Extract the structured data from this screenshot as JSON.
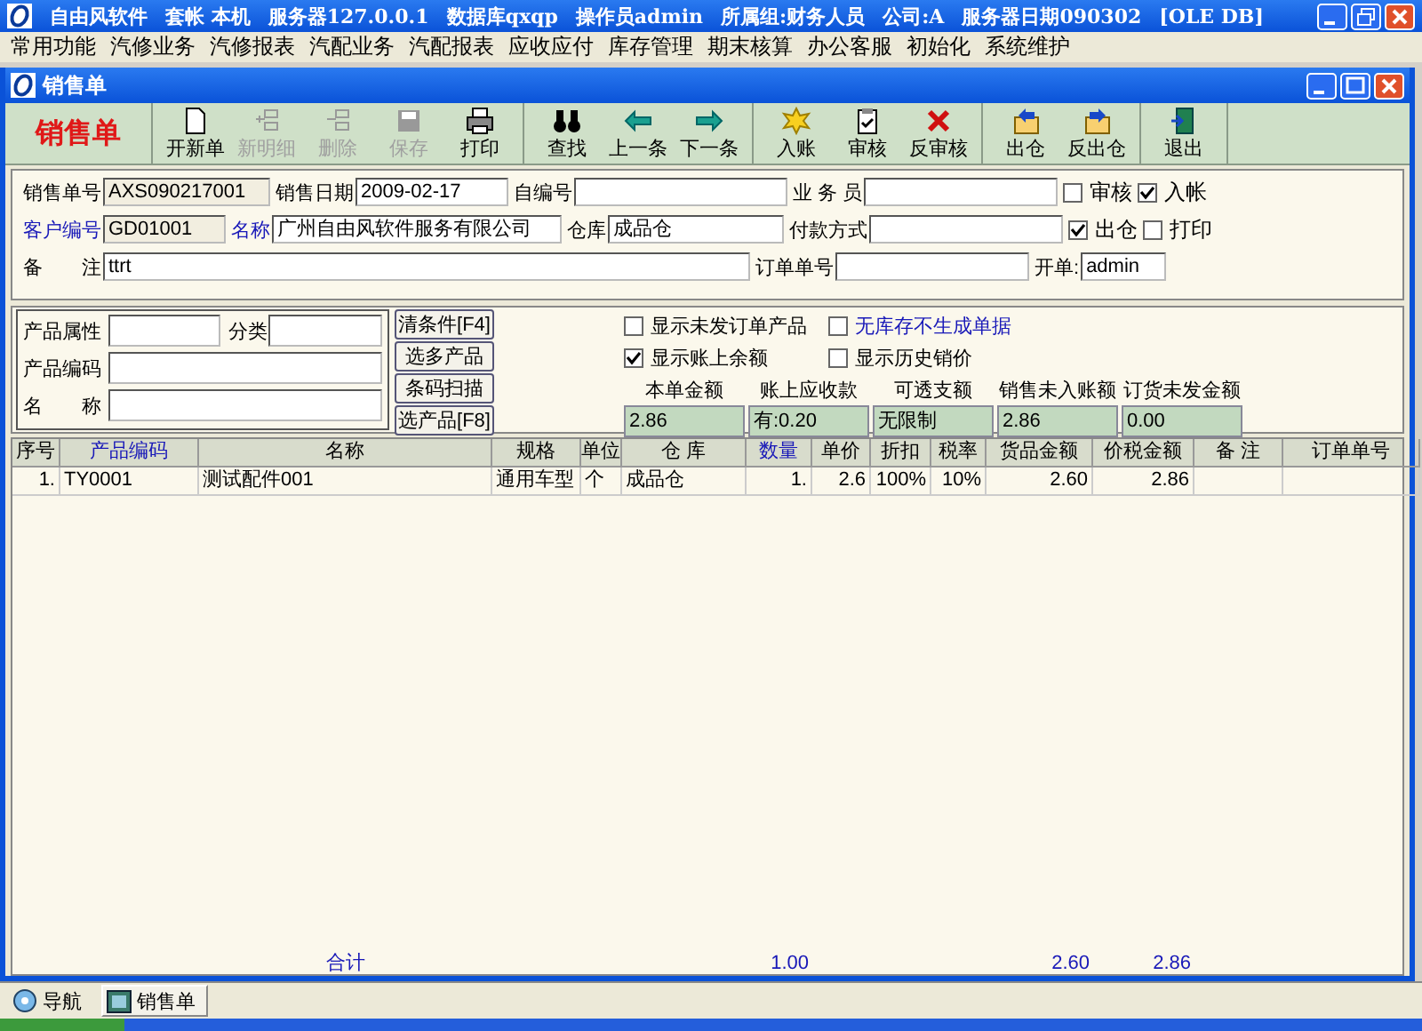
{
  "app_title": {
    "segments": [
      "自由风软件",
      "套帐 本机",
      "服务器127.0.0.1",
      "数据库qxqp",
      "操作员admin",
      "所属组:财务人员",
      "公司:A",
      "服务器日期090302",
      "[OLE DB]"
    ]
  },
  "menu": [
    "常用功能",
    "汽修业务",
    "汽修报表",
    "汽配业务",
    "汽配报表",
    "应收应付",
    "库存管理",
    "期末核算",
    "办公客服",
    "初始化",
    "系统维护"
  ],
  "window": {
    "title": "销售单"
  },
  "toolbar": {
    "heading": "销售单",
    "groups": [
      [
        {
          "kind": "new",
          "label": "开新单",
          "disabled": false
        },
        {
          "kind": "add-row",
          "label": "新明细",
          "disabled": true
        },
        {
          "kind": "delete",
          "label": "删除",
          "disabled": true
        },
        {
          "kind": "save",
          "label": "保存",
          "disabled": true
        },
        {
          "kind": "print",
          "label": "打印",
          "disabled": false
        }
      ],
      [
        {
          "kind": "find",
          "label": "查找",
          "disabled": false
        },
        {
          "kind": "prev",
          "label": "上一条",
          "disabled": false
        },
        {
          "kind": "next",
          "label": "下一条",
          "disabled": false
        }
      ],
      [
        {
          "kind": "post",
          "label": "入账",
          "disabled": false
        },
        {
          "kind": "audit",
          "label": "审核",
          "disabled": false
        },
        {
          "kind": "unaudit",
          "label": "反审核",
          "disabled": false
        }
      ],
      [
        {
          "kind": "out",
          "label": "出仓",
          "disabled": false
        },
        {
          "kind": "unout",
          "label": "反出仓",
          "disabled": false
        }
      ],
      [
        {
          "kind": "exit",
          "label": "退出",
          "disabled": false
        }
      ]
    ]
  },
  "form": {
    "fields": [
      {
        "kind": "field",
        "label": "销售单号",
        "value": "AXS090217001",
        "readonly": true,
        "link": false
      },
      {
        "kind": "field",
        "label": "销售日期",
        "value": "2009-02-17",
        "readonly": false,
        "link": false
      },
      {
        "kind": "field",
        "label": "自编号",
        "readonly": false,
        "link": false
      },
      {
        "kind": "field",
        "label": "业 务 员",
        "readonly": false,
        "link": false
      },
      {
        "kind": "check",
        "label": "审核",
        "checked": false
      },
      {
        "kind": "check",
        "label": "入帐",
        "checked": true
      },
      {
        "kind": "field",
        "label": "客户编号",
        "value": "GD01001",
        "readonly": true,
        "link": true
      },
      {
        "kind": "field",
        "label": "名称",
        "value": "广州自由风软件服务有限公司",
        "readonly": false,
        "link": true
      },
      {
        "kind": "field",
        "label": "仓库",
        "value": "成品仓",
        "readonly": false,
        "link": false
      },
      {
        "kind": "field",
        "label": "付款方式",
        "readonly": false,
        "link": false
      },
      {
        "kind": "check",
        "label": "出仓",
        "checked": true
      },
      {
        "kind": "check",
        "label": "打印",
        "checked": false
      },
      {
        "kind": "field",
        "label": "备　　注",
        "value": "ttrt",
        "readonly": false,
        "link": false
      },
      {
        "kind": "field",
        "label": "订单单号",
        "readonly": false,
        "link": false
      },
      {
        "kind": "field",
        "label": "开单:",
        "value": "admin",
        "readonly": false,
        "link": false
      }
    ]
  },
  "filter": {
    "fields": [
      {
        "label": "产品属性"
      },
      {
        "label": "分类"
      },
      {
        "label": "产品编码"
      },
      {
        "label": "名　　称"
      }
    ],
    "buttons": [
      "清条件[F4]",
      "选多产品",
      "条码扫描",
      "选产品[F8]"
    ],
    "options": [
      {
        "label": "显示未发订单产品",
        "checked": false,
        "link": false
      },
      {
        "label": "无库存不生成单据",
        "checked": false,
        "link": true
      },
      {
        "label": "显示账上余额",
        "checked": true,
        "link": false
      },
      {
        "label": "显示历史销价",
        "checked": false,
        "link": false
      }
    ],
    "summary": [
      {
        "label": "本单金额",
        "value": "2.86"
      },
      {
        "label": "账上应收款",
        "value": "有:0.20"
      },
      {
        "label": "可透支额",
        "value": "无限制"
      },
      {
        "label": "销售未入账额",
        "value": "2.86"
      },
      {
        "label": "订货未发金额",
        "value": "0.00"
      }
    ]
  },
  "table": {
    "columns": [
      {
        "label": "序号",
        "link": false
      },
      {
        "label": "产品编码",
        "link": true
      },
      {
        "label": "名称",
        "link": false
      },
      {
        "label": "规格",
        "link": false
      },
      {
        "label": "单位",
        "link": false
      },
      {
        "label": "仓 库",
        "link": false
      },
      {
        "label": "数量",
        "link": true
      },
      {
        "label": "单价",
        "link": false
      },
      {
        "label": "折扣",
        "link": false
      },
      {
        "label": "税率",
        "link": false
      },
      {
        "label": "货品金额",
        "link": false
      },
      {
        "label": "价税金额",
        "link": false
      },
      {
        "label": "备 注",
        "link": false
      },
      {
        "label": "订单单号",
        "link": false
      }
    ],
    "rows": [
      [
        "1.",
        "TY0001",
        "测试配件001",
        "通用车型",
        "个",
        "成品仓",
        "1.",
        "2.6",
        "100%",
        "10%",
        "2.60",
        "2.86",
        null,
        null
      ]
    ],
    "totals": {
      "label": "合计",
      "quantity": "1.00",
      "amount": "2.60",
      "amount_with_tax": "2.86"
    }
  },
  "taskbar": [
    {
      "label": "导航",
      "selected": false
    },
    {
      "label": "销售单",
      "selected": true
    }
  ]
}
